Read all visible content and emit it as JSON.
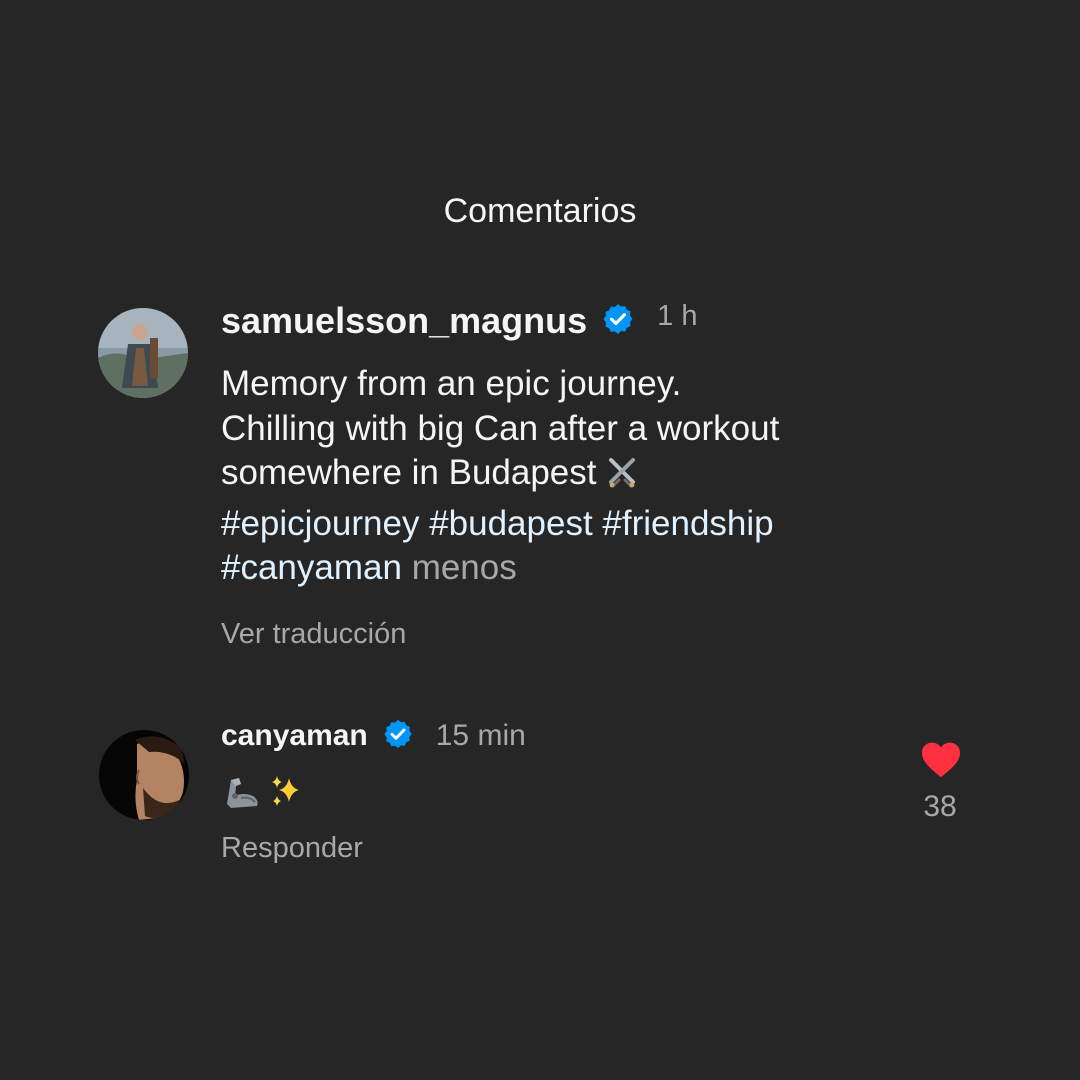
{
  "header": {
    "title": "Comentarios"
  },
  "post": {
    "username": "samuelsson_magnus",
    "verified_icon": "verified-badge-icon",
    "time": "1 h",
    "caption_lines": [
      "Memory from an epic journey.",
      "Chilling with big Can after a workout",
      "somewhere in Budapest"
    ],
    "caption_emoji": "crossed-swords-icon",
    "hashtags_line1": "#epicjourney #budapest #friendship",
    "hashtags_line2": "#canyaman",
    "less_label": "menos",
    "translate_label": "Ver traducción"
  },
  "comment": {
    "username": "canyaman",
    "verified_icon": "verified-badge-icon",
    "time": "15 min",
    "text_emojis": [
      "mechanical-arm-icon",
      "sparkles-icon"
    ],
    "reply_label": "Responder",
    "like_icon": "heart-icon",
    "like_count": "38"
  },
  "colors": {
    "background": "#262626",
    "primary_text": "#f5f5f5",
    "secondary_text": "#a8a8a8",
    "hashtag": "#e0f1ff",
    "verified": "#0095f6",
    "like": "#ff3040"
  }
}
